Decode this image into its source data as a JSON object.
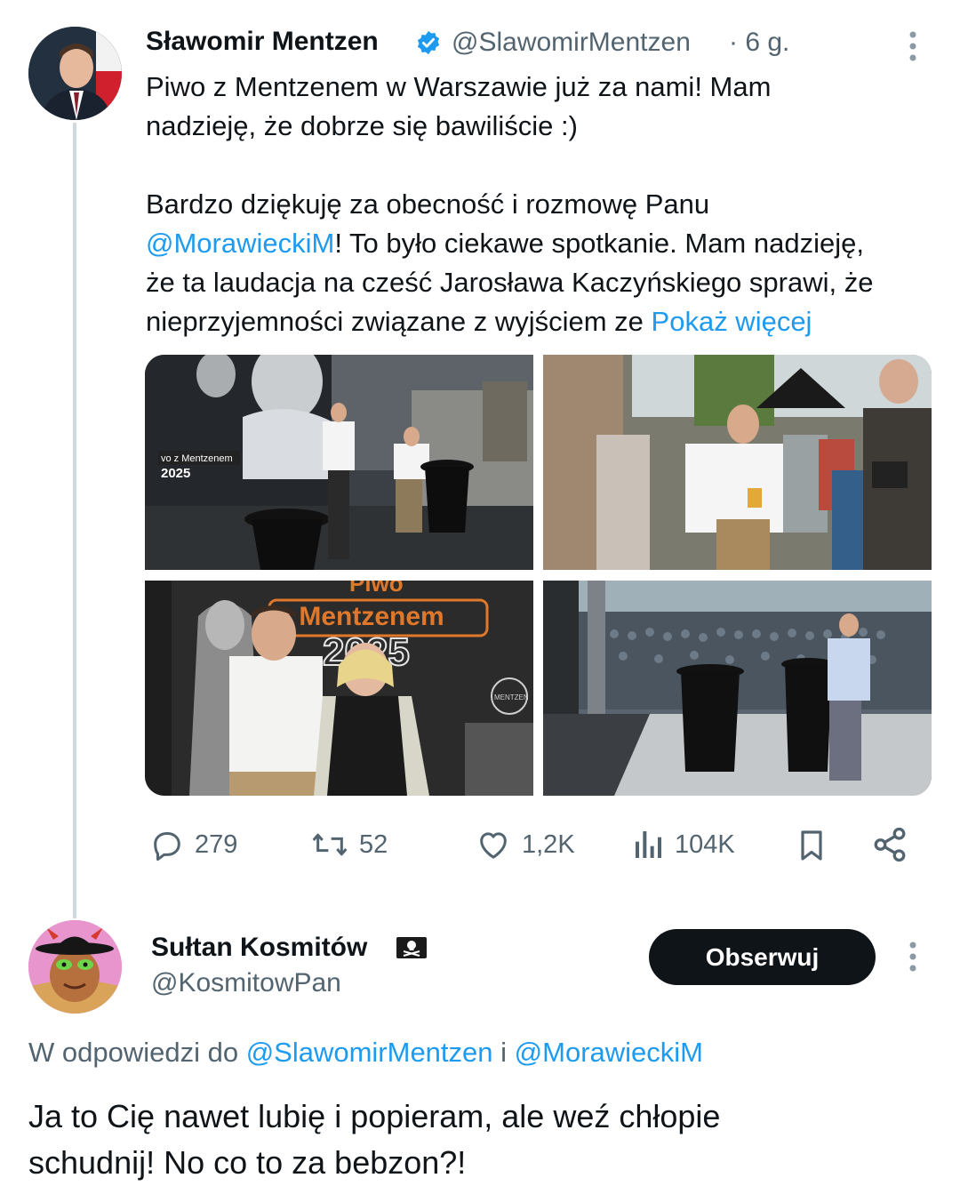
{
  "main_tweet": {
    "author_name": "Sławomir Mentzen",
    "author_handle": "@SlawomirMentzen",
    "time": "· 6 g.",
    "text_lines": [
      "Piwo z Mentzenem w Warszawie już za nami! Mam",
      "nadzieję, że dobrze się bawiliście :)",
      "Bardzo dziękuję za obecność i rozmowę Panu"
    ],
    "mention": "@MorawieckiM",
    "line_after_mention": "! To było ciekawe spotkanie. Mam nadzieję,",
    "line_5": "że ta laudacja na cześć Jarosława Kaczyńskiego sprawi, że",
    "line_6": "nieprzyjemności związane z wyjściem ze ",
    "show_more": "Pokaż więcej",
    "media_text": {
      "screen_line1": "vo z Mentzenem",
      "screen_line2": "2025",
      "banner_top": "Piwo",
      "banner_main": "z Mentzenem",
      "banner_year": "2025",
      "badge": "MENTZEN"
    },
    "stats": {
      "replies": "279",
      "retweets": "52",
      "likes": "1,2K",
      "views": "104K"
    }
  },
  "reply": {
    "author_name": "Sułtan Kosmitów",
    "author_handle": "@KosmitowPan",
    "follow_label": "Obserwuj",
    "in_reply_prefix": "W odpowiedzi do ",
    "in_reply_user1": "@SlawomirMentzen",
    "in_reply_and": " i ",
    "in_reply_user2": "@MorawieckiM",
    "text_lines": [
      "Ja to Cię nawet lubię i popieram, ale weź chłopie",
      "schudnij! No co to za bebzon?!"
    ]
  },
  "colors": {
    "link": "#1d9bf0",
    "secondary_text": "#536471",
    "verified": "#1d9bf0",
    "follow_bg": "#0f1419"
  },
  "icons": [
    "verified-badge-icon",
    "more-options-icon",
    "reply-icon",
    "retweet-icon",
    "like-icon",
    "views-icon",
    "bookmark-icon",
    "share-icon",
    "pirate-flag-icon"
  ]
}
